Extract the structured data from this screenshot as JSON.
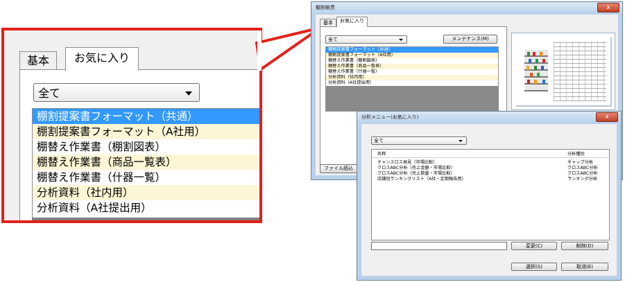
{
  "zoom": {
    "tabs": [
      "基本",
      "お気に入り"
    ],
    "filter_value": "全て",
    "items": [
      "棚割提案書フォーマット（共通）",
      "棚割提案書フォーマット（A社用）",
      "棚替え作業書（棚割図表）",
      "棚替え作業書（商品一覧表）",
      "棚替え作業書（什器一覧）",
      "分析資料（社内用）",
      "分析資料（A社提出用）"
    ]
  },
  "window1": {
    "title": "棚割帳票",
    "close_label": "x",
    "tabs": [
      "基本",
      "お気に入り"
    ],
    "filter_value": "全て",
    "maintenance_label": "メンテナンス(M)",
    "file_load_label": "ファイル読込",
    "items": [
      "棚割提案書フォーマット（共通）",
      "棚割提案書フォーマット（A社用）",
      "棚替え作業書（棚割図表）",
      "棚替え作業書（商品一覧表）",
      "棚替え作業書（什器一覧）",
      "分析資料（社内用）",
      "分析資料（A社提出用）"
    ]
  },
  "window2": {
    "title": "分析メニュー(お気に入り)",
    "close_label": "x",
    "filter_value": "全て",
    "columns": [
      "名称",
      "分析種別"
    ],
    "rows": [
      {
        "name": "チャンスロス発見（市場比較）",
        "type": "ギャップ分析"
      },
      {
        "name": "クロスABC分析（売上金額・市場比較）",
        "type": "クロスABC分析"
      },
      {
        "name": "クロスABC分析（売上数量・市場比較）",
        "type": "クロスABC分析"
      },
      {
        "name": "店舗別ランキングリスト（A社・定期報告用）",
        "type": "ランキング分析"
      }
    ],
    "name_input_value": "",
    "change_label": "変更(C)",
    "delete_label": "削除(D)",
    "select_label": "選択(S)",
    "cancel_label": "取消(E)"
  },
  "colors": {
    "callout": "#e3201b",
    "selection": "#3399ff",
    "alt_row": "#fdf6d6"
  }
}
